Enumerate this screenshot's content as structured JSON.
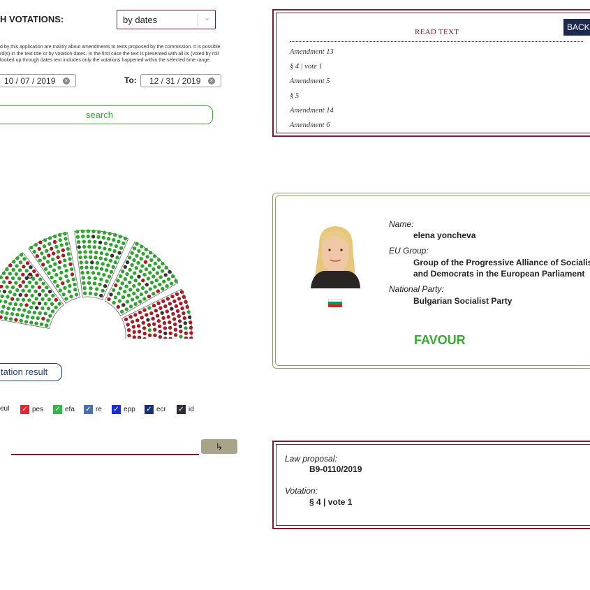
{
  "search": {
    "title": "H VOTATIONS:",
    "mode_selected": "by dates",
    "info_lines": [
      "d by this application are mainly about amendments to texts proposed by the commission. It is possible",
      "rd(s) in the text title or by votation dates. In the first case the text is presented with all its (voted by roll",
      "looked up through dates text includes only the votations happened within the selected time range."
    ],
    "from_date": "10 / 07 / 2019",
    "to_label": "To:",
    "to_date": "12 / 31 / 2019",
    "search_label": "search",
    "result_label": "tation result",
    "go_symbol": "↳"
  },
  "legend": [
    {
      "label": "eul",
      "color": "#ffffff",
      "checked": false
    },
    {
      "label": "pes",
      "color": "#e8232a",
      "checked": true
    },
    {
      "label": "efa",
      "color": "#37b34a",
      "checked": true
    },
    {
      "label": "re",
      "color": "#4a6fb5",
      "checked": true
    },
    {
      "label": "epp",
      "color": "#1b2ddb",
      "checked": true
    },
    {
      "label": "ecr",
      "color": "#15307a",
      "checked": true
    },
    {
      "label": "id",
      "color": "#2e2e3a",
      "checked": true
    }
  ],
  "read_text": {
    "title": "READ TEXT",
    "back_label": "BACK",
    "items": [
      "Amendment 13",
      "§ 4 | vote 1",
      "Amendment 5",
      "§ 5",
      "Amendment 14",
      "Amendment 6"
    ]
  },
  "mep": {
    "name_label": "Name:",
    "name": "elena yoncheva",
    "group_label": "EU Group:",
    "group_line1": "Group of the Progressive Alliance of Socialists",
    "group_line2": "and Democrats in the European Parliament",
    "party_label": "National Party:",
    "party": "Bulgarian Socialist Party",
    "vote": "FAVOUR",
    "flag_colors": [
      "#ffffff",
      "#00966e",
      "#d62612"
    ]
  },
  "votation": {
    "law_label": "Law proposal:",
    "law_value": "B9-0110/2019",
    "votation_label": "Votation:",
    "votation_value": "§ 4 | vote 1"
  },
  "colors": {
    "favour": "#2fa52f",
    "against": "#a51c24",
    "abstain": "#333333",
    "accent": "#7b1a30"
  }
}
